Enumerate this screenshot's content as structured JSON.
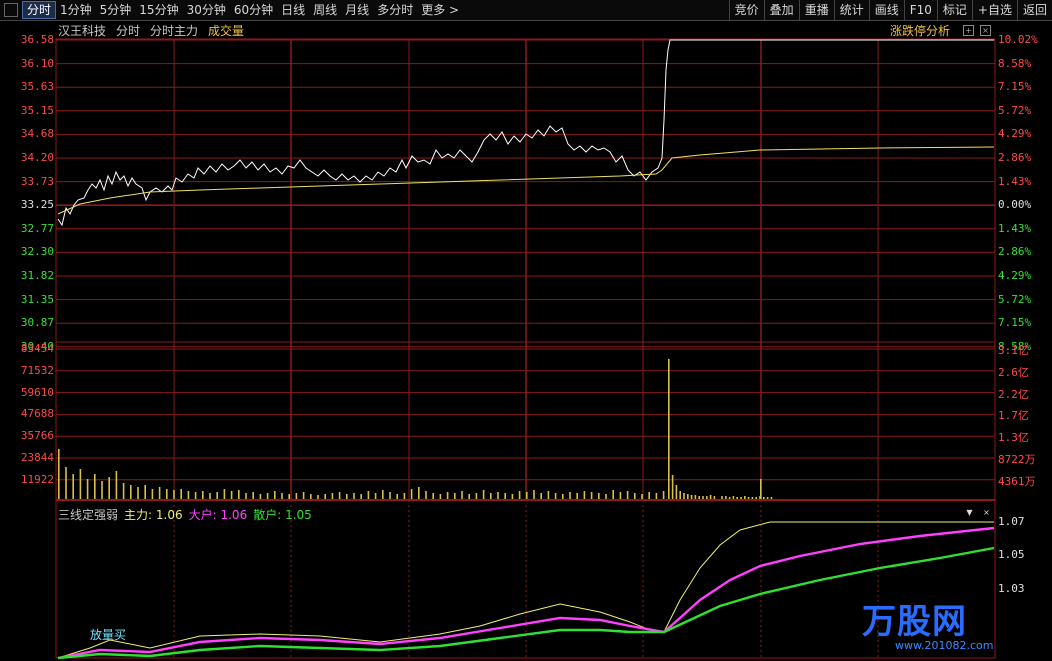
{
  "toolbar": {
    "tabs": [
      "分时",
      "1分钟",
      "5分钟",
      "15分钟",
      "30分钟",
      "60分钟",
      "日线",
      "周线",
      "月线",
      "多分时",
      "更多 >"
    ],
    "right": [
      "竞价",
      "叠加",
      "重播",
      "统计",
      "画线",
      "F10",
      "标记",
      "+自选",
      "返回"
    ]
  },
  "header": {
    "stock_name": "汉王科技",
    "mode": "分时",
    "main_force": "分时主力",
    "volume": "成交量",
    "analysis": "涨跌停分析"
  },
  "price_axis": {
    "left": [
      "36.58",
      "36.10",
      "35.63",
      "35.15",
      "34.68",
      "34.20",
      "33.73",
      "33.25",
      "32.77",
      "32.30",
      "31.82",
      "31.35",
      "30.87",
      "30.40"
    ],
    "right": [
      "10.02%",
      "8.58%",
      "7.15%",
      "5.72%",
      "4.29%",
      "2.86%",
      "1.43%",
      "0.00%",
      "1.43%",
      "2.86%",
      "4.29%",
      "5.72%",
      "7.15%",
      "8.58%"
    ]
  },
  "volume_axis": {
    "left": [
      "83454",
      "71532",
      "59610",
      "47688",
      "35766",
      "23844",
      "11922"
    ],
    "right": [
      "3.1亿",
      "2.6亿",
      "2.2亿",
      "1.7亿",
      "1.3亿",
      "8722万",
      "4361万"
    ]
  },
  "indicator": {
    "name": "三线定强弱",
    "main_label": "主力:",
    "main_value": "1.06",
    "big_label": "大户:",
    "big_value": "1.06",
    "retail_label": "散户:",
    "retail_value": "1.05",
    "axis": [
      "1.07",
      "1.05",
      "1.03"
    ],
    "tip": "放量买"
  },
  "colors": {
    "grid": "#8b1a1a",
    "price_line": "#ffffff",
    "avg_line": "#f0e060",
    "volume_bar": "#d8c048",
    "main_line": "#f0f070",
    "big_line": "#ff40ff",
    "retail_line": "#30e030"
  },
  "watermark": {
    "logo": "万股网",
    "url": "www.201082.com"
  }
}
